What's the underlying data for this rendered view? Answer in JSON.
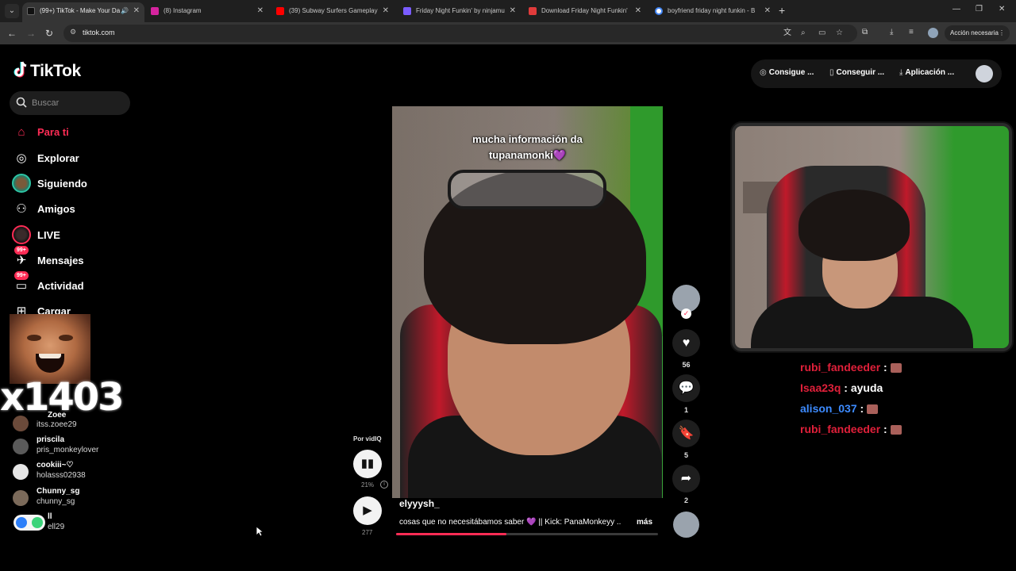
{
  "browser": {
    "tabs": [
      {
        "title": "(99+) TikTok - Make Your Da",
        "active": true,
        "favicon_color": "#111111",
        "audio": true
      },
      {
        "title": "(8) Instagram",
        "active": false,
        "favicon_color": "#d6249f"
      },
      {
        "title": "(39) Subway Surfers Gameplay",
        "active": false,
        "favicon_color": "#ff0000"
      },
      {
        "title": "Friday Night Funkin' by ninjamu",
        "active": false,
        "favicon_color": "#7a5cff"
      },
      {
        "title": "Download Friday Night Funkin'",
        "active": false,
        "favicon_color": "#e03b3b"
      },
      {
        "title": "boyfriend friday night funkin - B",
        "active": false,
        "favicon_color": "#4285f4"
      }
    ],
    "url": "tiktok.com",
    "action_button": "Acción necesaria"
  },
  "tiktok": {
    "logo_text": "TikTok",
    "search_placeholder": "Buscar",
    "nav": [
      {
        "label": "Para ti",
        "active": true
      },
      {
        "label": "Explorar"
      },
      {
        "label": "Siguiendo"
      },
      {
        "label": "Amigos"
      },
      {
        "label": "LIVE"
      },
      {
        "label": "Mensajes",
        "badge": "99+"
      },
      {
        "label": "Actividad",
        "badge": "99+"
      },
      {
        "label": "Cargar"
      }
    ],
    "overlay_number": "x1403",
    "following": [
      {
        "name": "Zoee",
        "username": "itss.zoee29"
      },
      {
        "name": "priscila",
        "username": "pris_monkeylover"
      },
      {
        "name": "cookiii~♡",
        "username": "holasss02938"
      },
      {
        "name": "Chunny_sg",
        "username": "chunny_sg"
      },
      {
        "name": "ll",
        "username": "ell29"
      }
    ],
    "header": {
      "coins": "Consigue ...",
      "get_app": "Conseguir ...",
      "app": "Aplicación ..."
    }
  },
  "video": {
    "caption_overlay": [
      "mucha información da",
      "tupanamonki💜"
    ],
    "author": "elyyysh_",
    "description": "cosas que no necesitábamos saber 💜 || Kick: PanaMonkeyy ..",
    "more_label": "más",
    "progress": 0.42,
    "likes": "56",
    "comments": "1",
    "saves": "5",
    "shares": "2"
  },
  "vidiq": {
    "label": "Por vidIQ",
    "percent": "21%",
    "count": "277"
  },
  "chat": [
    {
      "user": "rubi_fandeeder",
      "color": "#e0203a",
      "message": ""
    },
    {
      "user": "Isaa23q",
      "color": "#e0203a",
      "message": "ayuda"
    },
    {
      "user": "alison_037",
      "color": "#3d8bff",
      "message": ""
    },
    {
      "user": "rubi_fandeeder",
      "color": "#e0203a",
      "message": ""
    }
  ],
  "colors": {
    "accent": "#fe2c55"
  }
}
